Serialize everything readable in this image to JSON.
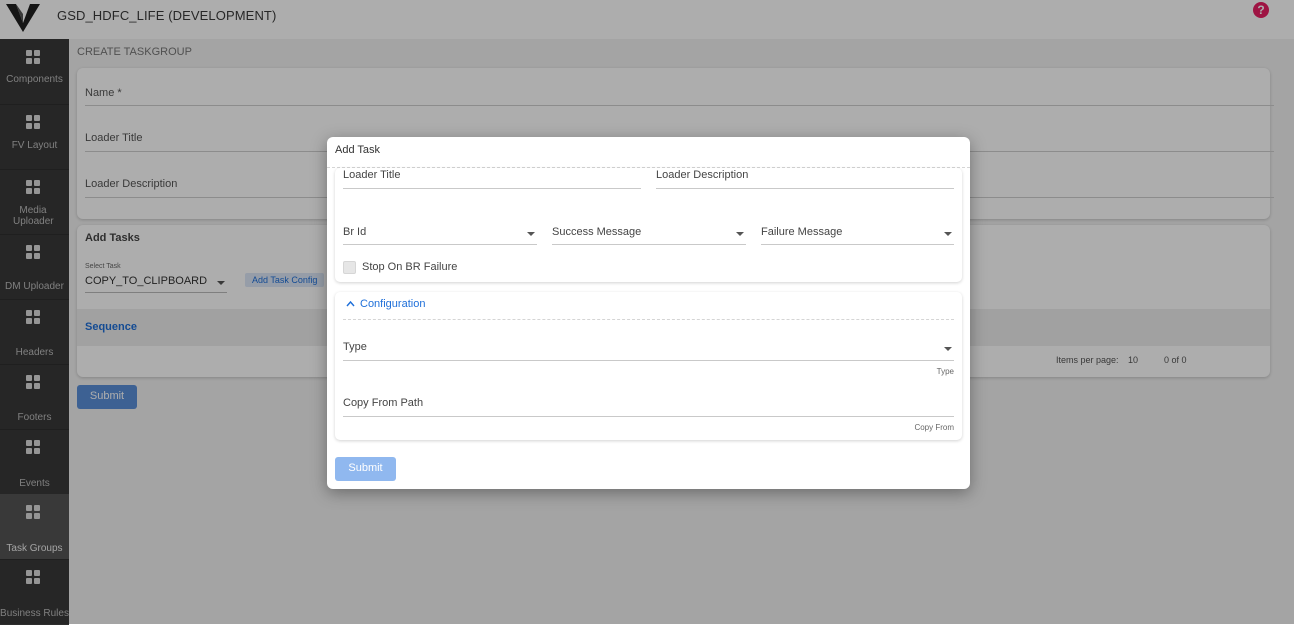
{
  "app": {
    "title": "GSD_HDFC_LIFE (DEVELOPMENT)",
    "help_icon": "?"
  },
  "sidebar": {
    "items": [
      {
        "label": "Components",
        "icon": "grid-icon"
      },
      {
        "label": "FV Layout",
        "icon": "grid-icon"
      },
      {
        "label": "Media Uploader",
        "icon": "grid-icon"
      },
      {
        "label": "DM Uploader",
        "icon": "grid-icon"
      },
      {
        "label": "Headers",
        "icon": "grid-icon"
      },
      {
        "label": "Footers",
        "icon": "grid-icon"
      },
      {
        "label": "Events",
        "icon": "grid-icon"
      },
      {
        "label": "Task Groups",
        "icon": "grid-icon",
        "active": true
      },
      {
        "label": "Business Rules",
        "icon": "grid-icon"
      }
    ]
  },
  "page": {
    "title": "CREATE TASKGROUP",
    "form": {
      "name_label": "Name *",
      "loader_title_label": "Loader Title",
      "loader_description_label": "Loader Description"
    },
    "add_tasks": {
      "title": "Add Tasks",
      "select_task_label": "Select Task",
      "select_task_value": "COPY_TO_CLIPBOARD",
      "add_task_config_label": "Add Task Config",
      "table_header_sequence": "Sequence",
      "items_per_page_label": "Items per page:",
      "items_per_page_value": "10",
      "range_label": "0 of 0"
    },
    "submit_label": "Submit"
  },
  "modal": {
    "title": "Add Task",
    "loader_title_label": "Loader Title",
    "loader_description_label": "Loader Description",
    "br_id_label": "Br Id",
    "success_message_label": "Success Message",
    "failure_message_label": "Failure Message",
    "stop_on_br_failure_label": "Stop On BR Failure",
    "configuration_label": "Configuration",
    "type_label": "Type",
    "type_hint": "Type",
    "copy_from_path_label": "Copy From Path",
    "copy_from_hint": "Copy From",
    "submit_label": "Submit"
  },
  "colors": {
    "accent": "#1e6fd9",
    "help": "#e91e63",
    "sidebar_bg": "#393939",
    "submit": "#90b8ef"
  }
}
